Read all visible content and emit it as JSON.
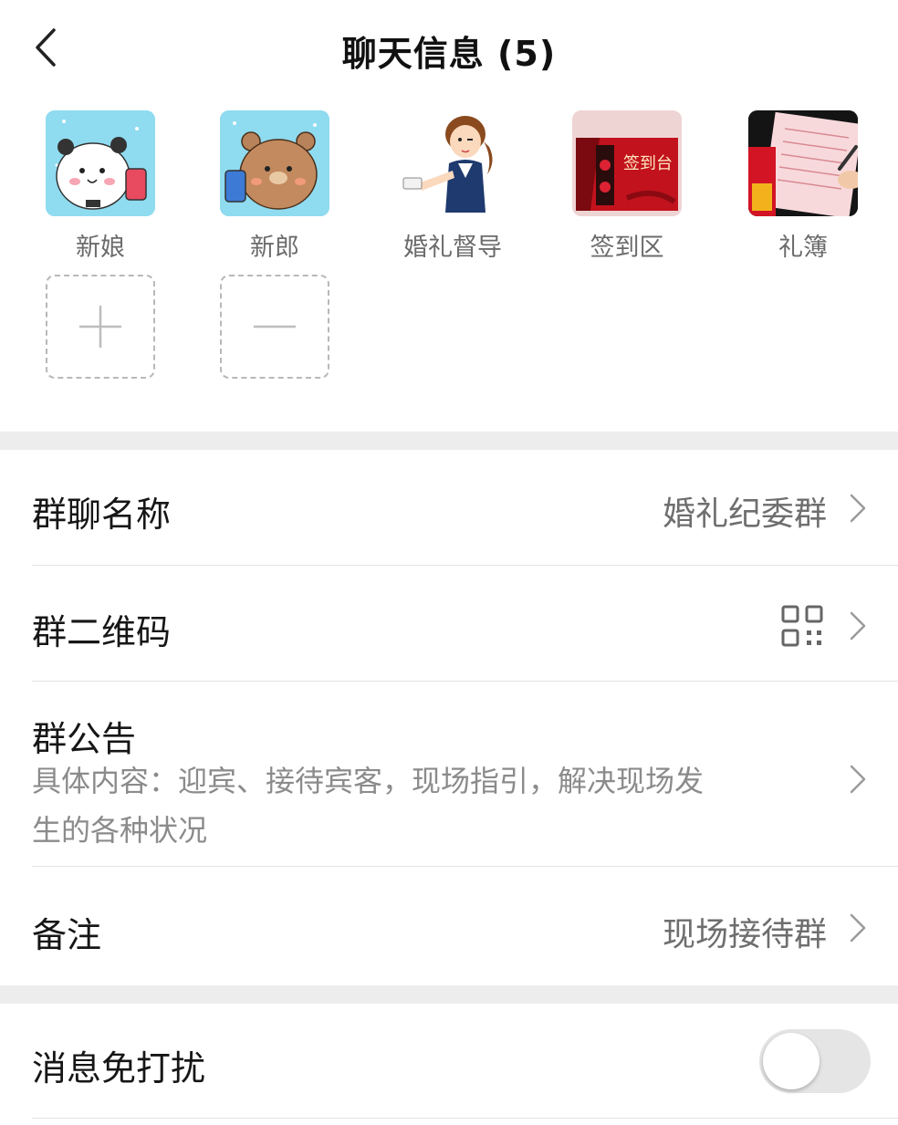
{
  "header": {
    "title": "聊天信息 (5)",
    "back_icon": "chevron-left-icon"
  },
  "members": [
    {
      "name": "新娘",
      "avatar": "bride-panda-avatar"
    },
    {
      "name": "新郎",
      "avatar": "groom-bear-avatar"
    },
    {
      "name": "婚礼督导",
      "avatar": "wedding-supervisor-avatar"
    },
    {
      "name": "签到区",
      "avatar": "checkin-area-avatar",
      "avatar_text": "签到台"
    },
    {
      "name": "礼簿",
      "avatar": "gift-book-avatar"
    }
  ],
  "member_actions": {
    "add_icon": "plus-icon",
    "remove_icon": "minus-icon"
  },
  "group_name": {
    "label": "群聊名称",
    "value": "婚礼纪委群"
  },
  "group_qr": {
    "label": "群二维码",
    "icon": "qr-code-icon"
  },
  "group_notice": {
    "label": "群公告",
    "line1": "具体内容：迎宾、接待宾客，现场指引，解决现场发",
    "line2": "生的各种状况"
  },
  "remark": {
    "label": "备注",
    "value": "现场接待群"
  },
  "mute": {
    "label": "消息免打扰",
    "enabled": false
  },
  "colors": {
    "background": "#ffffff",
    "section_gap": "#ededed",
    "secondary_text": "#6e6e6e",
    "toggle_off": "#e5e5e5"
  }
}
